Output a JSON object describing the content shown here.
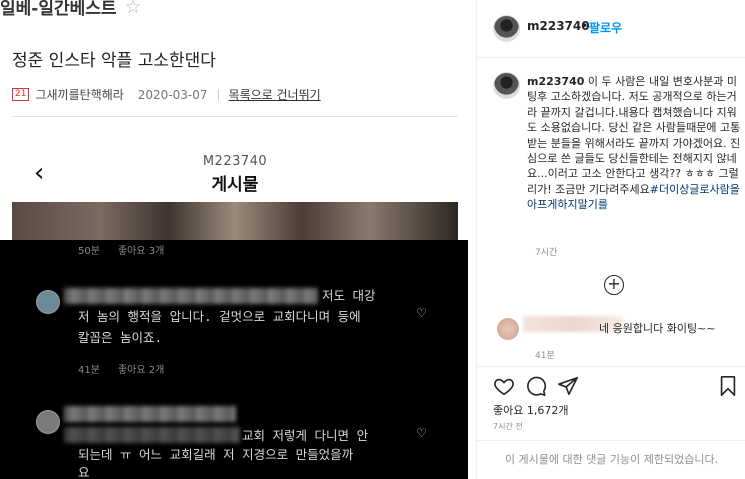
{
  "board": {
    "title": "일베-일간베스트",
    "star_icon": "star-outline-icon",
    "post_title": "정준 인스타 악플 고소한댄다",
    "author_level": "21",
    "author": "그새끼를탄핵해라",
    "date": "2020-03-07",
    "skip_link": "목록으로 건너뛰기"
  },
  "screenshot": {
    "username": "M223740",
    "page_title": "게시물",
    "back_icon": "chevron-left-icon",
    "top_meta": {
      "time": "50분",
      "likes": "좋아요 3개"
    },
    "comment1": {
      "tail": "저도 대강",
      "text_line2": "저 놈의 행적을 압니다. 겉멋으로 교회다니며 등에",
      "text_line3": "칼꼽은 놈이죠.",
      "time": "41분",
      "likes": "좋아요 2개"
    },
    "comment2": {
      "tail": "교회 저렇게 다니면 안",
      "text_line2": "되는데 ㅠ 어느 교회길래 저 지경으로 만들었을까",
      "text_line3": "요"
    }
  },
  "instagram": {
    "username": "m223740",
    "dot": "•",
    "follow": "팔로우",
    "caption_user": "m223740",
    "caption": "이 두 사람은 내일 변호사분과 미팅후 고소하겠습니다. 저도 공개적으로 하는거라 끝까지 갈겁니다.내용다 캡쳐했습니다 지워도 소용없습니다. 당신 같은 사람들때문에 고통받는 분들을 위해서라도 끝까지 가야겠어요. 진심으로 쓴 글들도 당신들한테는 전해지지 않네요...이러고 고소 안한다고 생각?? ㅎㅎㅎ 그럴리가! 조금만 기다려주세요",
    "caption_hashtag": "#더이상글로사람을아프게하지말기를",
    "caption_time": "7시간",
    "comment_text": "네 응원합니다 화이팅~~",
    "comment_time": "41분",
    "likes": "좋아요 1,672개",
    "post_time": "7시간 전",
    "restricted_notice": "이 게시물에 대한 댓글 기능이 제한되었습니다."
  }
}
